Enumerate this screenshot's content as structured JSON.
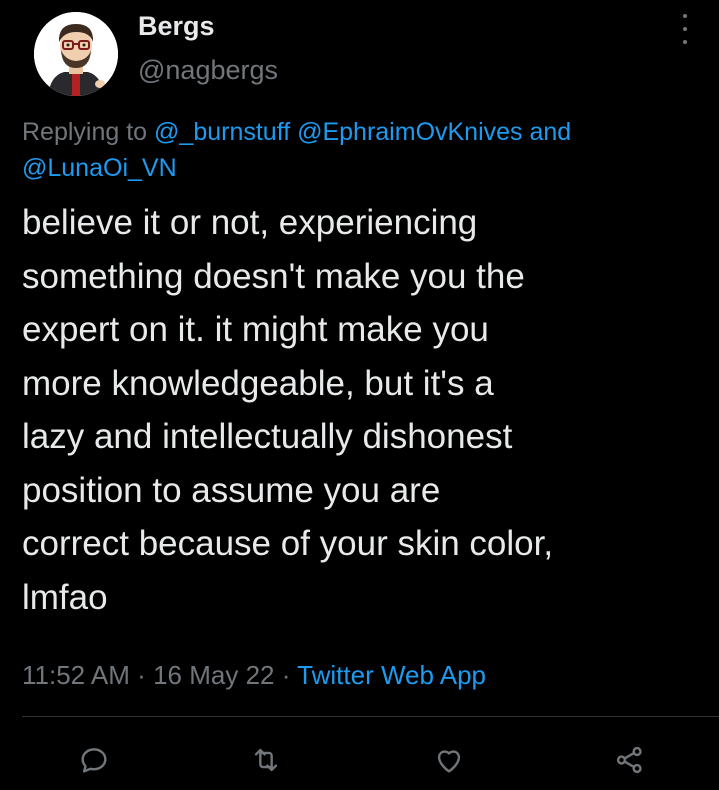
{
  "user": {
    "display_name": "Bergs",
    "handle": "@nagbergs",
    "avatar_icon": "cartoon-avatar-icon"
  },
  "reply": {
    "prefix": "Replying to",
    "mentions": [
      "@_burnstuff",
      "@EphraimOvKnives",
      "@LunaOi_VN"
    ],
    "joiner": "and"
  },
  "tweet": {
    "text": "believe it or not, experiencing\nsomething doesn't make you the\nexpert on it. it might make you\nmore knowledgeable, but it's a\nlazy and intellectually dishonest\nposition to assume you are\ncorrect because of your skin color,\nlmfao"
  },
  "meta": {
    "time": "11:52 AM",
    "separator": "·",
    "date": "16 May 22",
    "source": "Twitter Web App"
  },
  "actions": {
    "reply_icon": "reply-icon",
    "retweet_icon": "retweet-icon",
    "like_icon": "like-icon",
    "share_icon": "share-icon"
  },
  "colors": {
    "background": "#000000",
    "text": "#e7e9ea",
    "secondary": "#71767b",
    "accent": "#1d9bf0"
  }
}
